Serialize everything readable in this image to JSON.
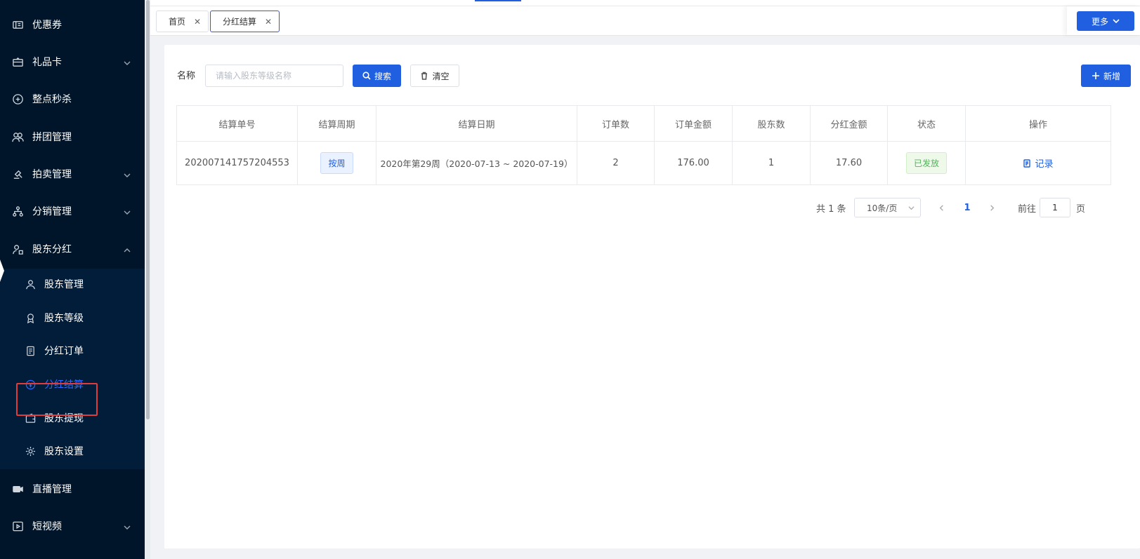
{
  "sidebar": {
    "items": [
      {
        "label": "优惠券",
        "icon": "ticket-icon",
        "has_children": false
      },
      {
        "label": "礼品卡",
        "icon": "gift-card-icon",
        "has_children": true
      },
      {
        "label": "整点秒杀",
        "icon": "flash-sale-icon",
        "has_children": false
      },
      {
        "label": "拼团管理",
        "icon": "group-icon",
        "has_children": false
      },
      {
        "label": "拍卖管理",
        "icon": "auction-icon",
        "has_children": true
      },
      {
        "label": "分销管理",
        "icon": "distribution-icon",
        "has_children": true
      },
      {
        "label": "股东分红",
        "icon": "shareholder-icon",
        "has_children": true,
        "expanded": true
      }
    ],
    "sub_items": [
      {
        "label": "股东管理",
        "icon": "user-icon"
      },
      {
        "label": "股东等级",
        "icon": "badge-icon"
      },
      {
        "label": "分红订单",
        "icon": "document-icon"
      },
      {
        "label": "分红结算",
        "icon": "settlement-icon",
        "active": true
      },
      {
        "label": "股东提现",
        "icon": "wallet-icon"
      },
      {
        "label": "股东设置",
        "icon": "gear-icon"
      }
    ],
    "bottom_items": [
      {
        "label": "直播管理",
        "icon": "video-camera-icon",
        "has_children": false
      },
      {
        "label": "短视频",
        "icon": "play-icon",
        "has_children": true
      }
    ]
  },
  "tabs": [
    {
      "label": "首页",
      "active": false
    },
    {
      "label": "分红结算",
      "active": true
    }
  ],
  "more_button": "更多",
  "filter": {
    "label": "名称",
    "placeholder": "请输入股东等级名称",
    "search_label": "搜索",
    "clear_label": "清空",
    "add_label": "新增"
  },
  "table": {
    "columns": [
      "结算单号",
      "结算周期",
      "结算日期",
      "订单数",
      "订单金额",
      "股东数",
      "分红金额",
      "状态",
      "操作"
    ],
    "rows": [
      {
        "settlement_no": "202007141757204553",
        "period": "按周",
        "date": "2020年第29周（2020-07-13 ~ 2020-07-19）",
        "order_count": "2",
        "order_amount": "176.00",
        "shareholder_count": "1",
        "dividend_amount": "17.60",
        "status": "已发放",
        "action": "记录"
      }
    ]
  },
  "pagination": {
    "total": "共 1 条",
    "page_size": "10条/页",
    "current_page": "1",
    "goto_label": "前往",
    "goto_value": "1",
    "page_suffix": "页"
  },
  "colors": {
    "primary": "#1f5fe0",
    "sidebar_bg": "#001529",
    "status_success": "#52b45a",
    "highlight_border": "#e23b3b"
  }
}
